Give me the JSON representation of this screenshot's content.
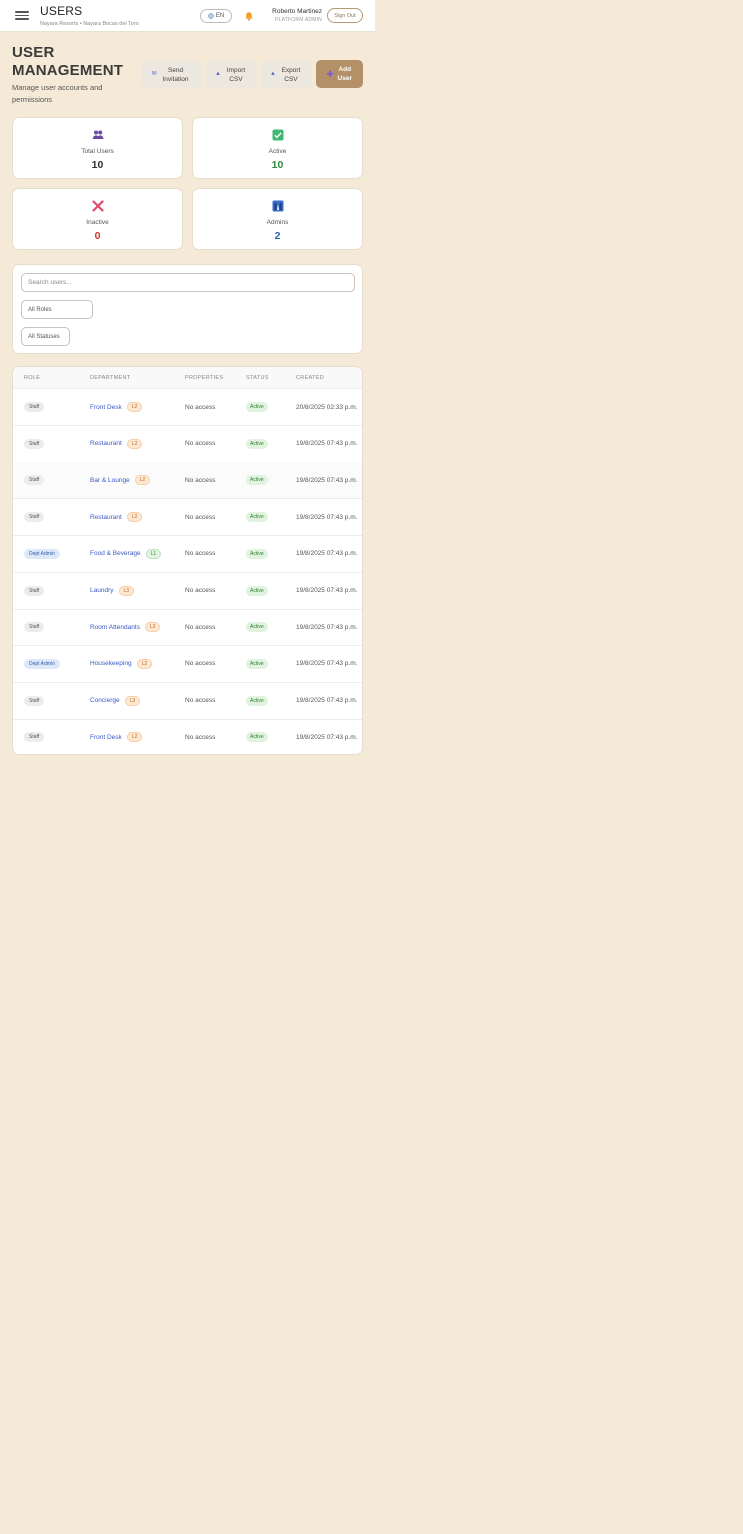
{
  "header": {
    "title": "USERS",
    "subtitle": "Nayara Resorts • Nayara Bocas del Toro",
    "language": "EN",
    "user_name": "Roberto Martinez",
    "user_role": "PLATFORM ADMIN",
    "sign_out": "Sign Out"
  },
  "page": {
    "title": "USER MANAGEMENT",
    "description": "Manage user accounts and permissions"
  },
  "actions": {
    "send_invitation": "Send Invitation",
    "import_csv": "Import CSV",
    "export_csv": "Export CSV",
    "add_user": "Add User"
  },
  "stats": [
    {
      "label": "Total Users",
      "value": "10",
      "color": "#333333"
    },
    {
      "label": "Active",
      "value": "10",
      "color": "#2e8b3e"
    },
    {
      "label": "Inactive",
      "value": "0",
      "color": "#c0392b"
    },
    {
      "label": "Admins",
      "value": "2",
      "color": "#2a62a8"
    }
  ],
  "filters": {
    "search_placeholder": "Search users...",
    "roles": "All Roles",
    "statuses": "All Statuses"
  },
  "table": {
    "columns": [
      "ROLE",
      "DEPARTMENT",
      "PROPERTIES",
      "STATUS",
      "CREATED"
    ],
    "rows": [
      {
        "role": "Staff",
        "department": "Front Desk",
        "level": "L2",
        "properties": "No access",
        "status": "Active",
        "created": "20/8/2025 02:33 p.m."
      },
      {
        "role": "Staff",
        "department": "Restaurant",
        "level": "L2",
        "properties": "No access",
        "status": "Active",
        "created": "19/8/2025 07:43 p.m."
      },
      {
        "role": "Staff",
        "department": "Bar & Lounge",
        "level": "L2",
        "properties": "No access",
        "status": "Active",
        "created": "19/8/2025 07:43 p.m."
      },
      {
        "role": "Staff",
        "department": "Restaurant",
        "level": "L2",
        "properties": "No access",
        "status": "Active",
        "created": "19/8/2025 07:43 p.m."
      },
      {
        "role": "Dept Admin",
        "department": "Food & Beverage",
        "level": "L1",
        "properties": "No access",
        "status": "Active",
        "created": "19/8/2025 07:43 p.m."
      },
      {
        "role": "Staff",
        "department": "Laundry",
        "level": "L3",
        "properties": "No access",
        "status": "Active",
        "created": "19/8/2025 07:43 p.m."
      },
      {
        "role": "Staff",
        "department": "Room Attendants",
        "level": "L3",
        "properties": "No access",
        "status": "Active",
        "created": "19/8/2025 07:43 p.m."
      },
      {
        "role": "Dept Admin",
        "department": "Housekeeping",
        "level": "L2",
        "properties": "No access",
        "status": "Active",
        "created": "19/8/2025 07:43 p.m."
      },
      {
        "role": "Staff",
        "department": "Concierge",
        "level": "L3",
        "properties": "No access",
        "status": "Active",
        "created": "19/8/2025 07:43 p.m."
      },
      {
        "role": "Staff",
        "department": "Front Desk",
        "level": "L2",
        "properties": "No access",
        "status": "Active",
        "created": "19/8/2025 07:43 p.m."
      }
    ]
  }
}
